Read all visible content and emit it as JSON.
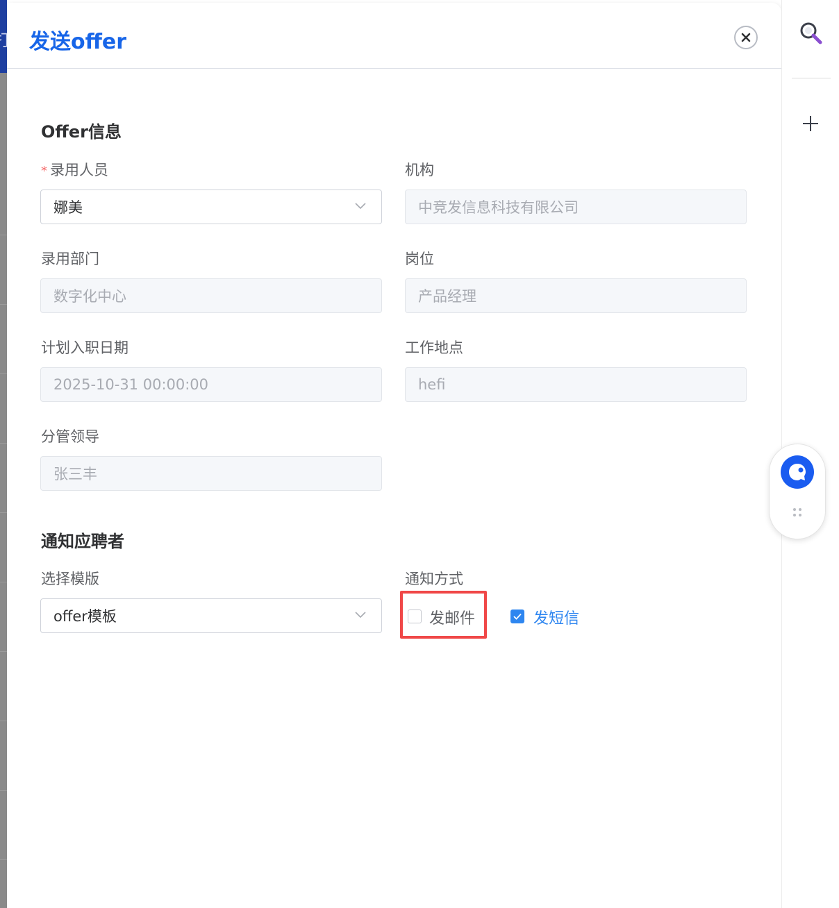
{
  "background": {
    "edge_glyph": "打"
  },
  "drawer": {
    "title": "发送offer",
    "close_icon": "close-circle-icon"
  },
  "offer_section": {
    "title": "Offer信息",
    "hire_person": {
      "label": "录用人员",
      "required_mark": "*",
      "value": "娜美"
    },
    "organization": {
      "label": "机构",
      "value": "中竞发信息科技有限公司"
    },
    "department": {
      "label": "录用部门",
      "value": "数字化中心"
    },
    "position": {
      "label": "岗位",
      "value": "产品经理"
    },
    "entry_date": {
      "label": "计划入职日期",
      "value": "2025-10-31 00:00:00"
    },
    "work_location": {
      "label": "工作地点",
      "value": "hefi"
    },
    "leader": {
      "label": "分管领导",
      "value": "张三丰"
    }
  },
  "notify_section": {
    "title": "通知应聘者",
    "template": {
      "label": "选择模版",
      "value": "offer模板"
    },
    "method": {
      "label": "通知方式",
      "email": {
        "label": "发邮件",
        "checked": false
      },
      "sms": {
        "label": "发短信",
        "checked": true
      }
    }
  },
  "colors": {
    "accent": "#1765e8",
    "highlight_border": "#f04848",
    "checkbox_checked": "#2e86f0"
  },
  "toolbar": {
    "icons": [
      "search-icon",
      "plus-icon"
    ],
    "widget_icon": "assistant-logo-icon"
  }
}
